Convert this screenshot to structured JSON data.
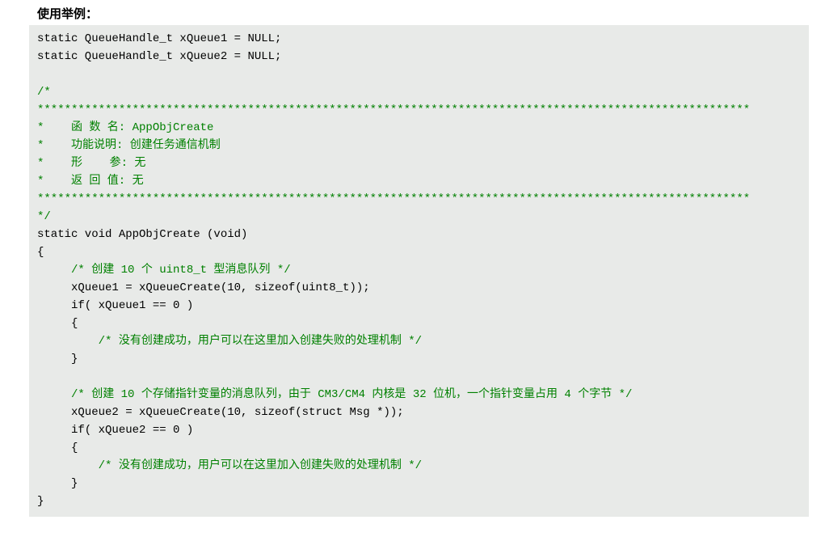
{
  "heading": "使用举例：",
  "code": {
    "l01": "static QueueHandle_t xQueue1 = NULL;",
    "l02": "static QueueHandle_t xQueue2 = NULL;",
    "l03": "",
    "l04": "/*",
    "l05": "*********************************************************************************************************",
    "l06": "*    函 数 名: AppObjCreate",
    "l07": "*    功能说明: 创建任务通信机制",
    "l08": "*    形    参: 无",
    "l09": "*    返 回 值: 无",
    "l10": "*********************************************************************************************************",
    "l11": "*/",
    "l12": "static void AppObjCreate (void)",
    "l13": "{",
    "l14": "     /* 创建 10 个 uint8_t 型消息队列 */",
    "l15": "     xQueue1 = xQueueCreate(10, sizeof(uint8_t));",
    "l16": "     if( xQueue1 == 0 )",
    "l17": "     {",
    "l18": "         /* 没有创建成功，用户可以在这里加入创建失败的处理机制 */",
    "l19": "     }",
    "l20": "",
    "l21": "     /* 创建 10 个存储指针变量的消息队列，由于 CM3/CM4 内核是 32 位机，一个指针变量占用 4 个字节 */",
    "l22": "     xQueue2 = xQueueCreate(10, sizeof(struct Msg *));",
    "l23": "     if( xQueue2 == 0 )",
    "l24": "     {",
    "l25": "         /* 没有创建成功，用户可以在这里加入创建失败的处理机制 */",
    "l26": "     }",
    "l27": "}"
  }
}
